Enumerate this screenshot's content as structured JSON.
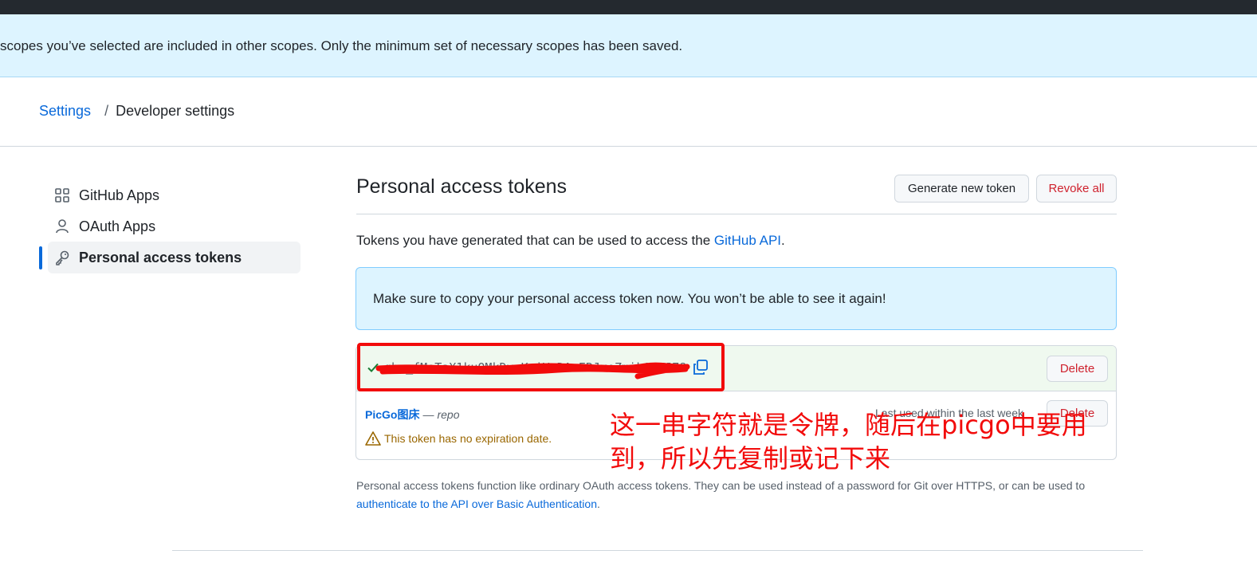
{
  "flash": {
    "message": "scopes you’ve selected are included in other scopes. Only the minimum set of necessary scopes has been saved."
  },
  "breadcrumb": {
    "root": "Settings",
    "separator": "/",
    "current": "Developer settings"
  },
  "sidebar": {
    "items": [
      {
        "label": "GitHub Apps",
        "icon": "apps-grid-icon"
      },
      {
        "label": "OAuth Apps",
        "icon": "person-icon"
      },
      {
        "label": "Personal access tokens",
        "icon": "key-icon",
        "active": true
      }
    ]
  },
  "main": {
    "title": "Personal access tokens",
    "generate_button": "Generate new token",
    "revoke_button": "Revoke all",
    "description_prefix": "Tokens you have generated that can be used to access the ",
    "description_link": "GitHub API",
    "description_suffix": ".",
    "info_message": "Make sure to copy your personal access token now. You won’t be able to see it again!"
  },
  "tokens": {
    "new_token": {
      "value": "ghp_fMeTaX1kuQMkDvpKmiVzDAvERJxeZmikQMKJ78",
      "delete_label": "Delete"
    },
    "existing_token": {
      "name": "PicGo图床",
      "dash": "—",
      "scope": "repo",
      "last_used": "Last used within the last week",
      "warning": "This token has no expiration date.",
      "delete_label": "Delete"
    }
  },
  "annotation": {
    "text": "这一串字符就是令牌，随后在picgo中要用到，所以先复制或记下来",
    "color": "#f20b0b"
  },
  "footer": {
    "text": "Personal access tokens function like ordinary OAuth access tokens. They can be used instead of a password for Git over HTTPS, or can be used to ",
    "link": "authenticate to the API over Basic Authentication",
    "suffix": "."
  },
  "colors": {
    "accent": "#0969da",
    "danger": "#cf222e",
    "flash_bg": "#ddf4ff",
    "success_bg": "#eff9ef"
  }
}
